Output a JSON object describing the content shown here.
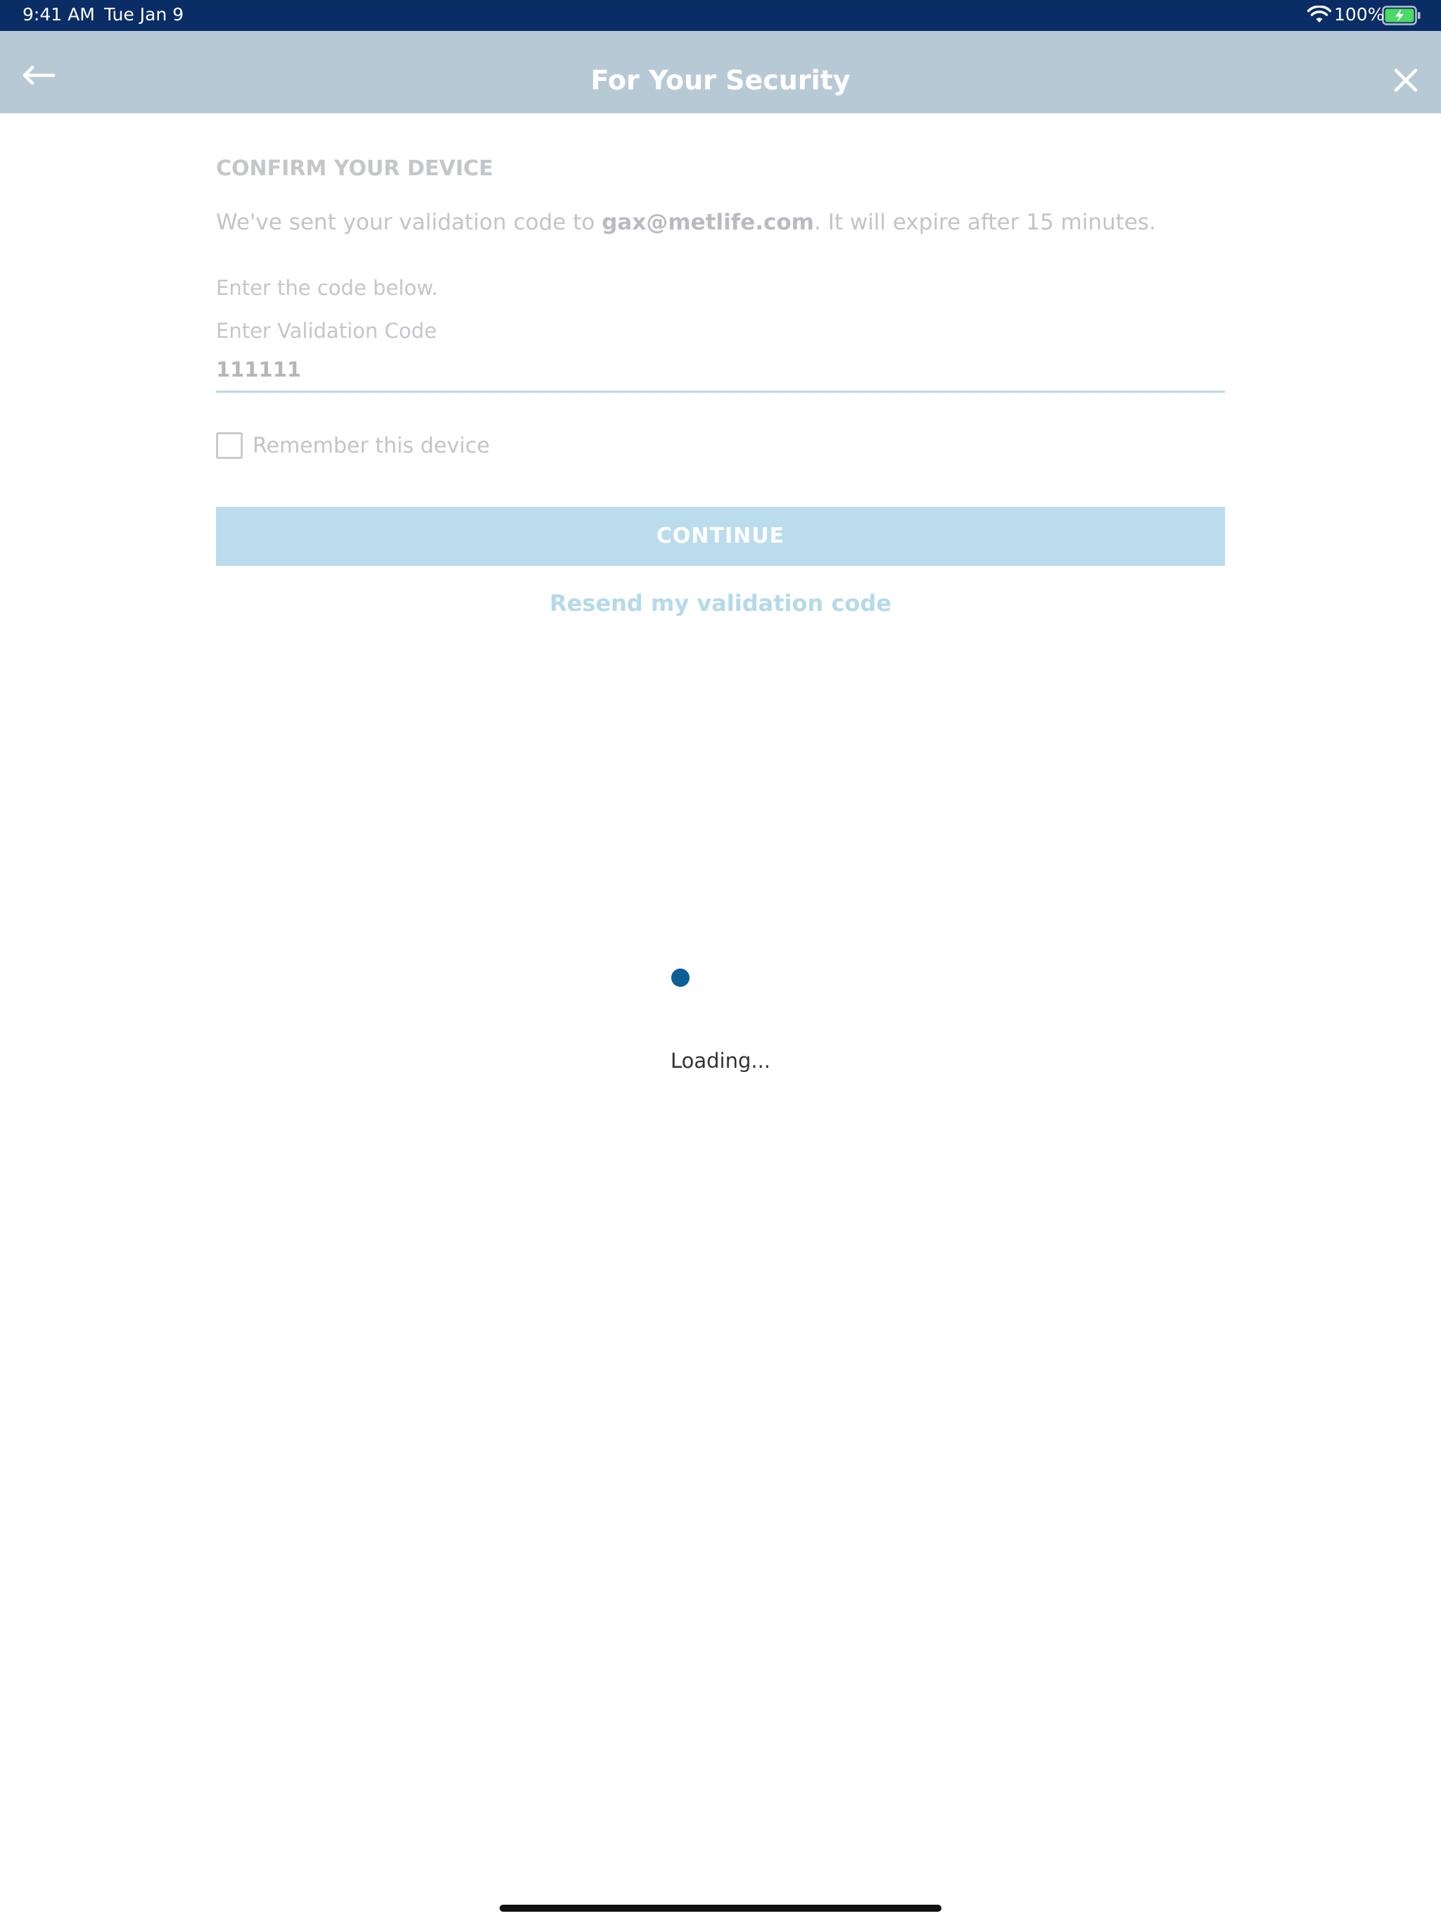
{
  "status_bar": {
    "time": "9:41 AM",
    "date": "Tue Jan 9",
    "battery_percent": "100%",
    "battery_level": 1.0,
    "wifi_icon": "wifi-icon",
    "battery_icon": "battery-charging-icon"
  },
  "nav": {
    "title": "For Your Security",
    "back_icon": "arrow-left-icon",
    "close_icon": "close-icon"
  },
  "confirm": {
    "heading": "CONFIRM YOUR DEVICE",
    "sent_prefix": "We've sent your validation code to ",
    "email": "gax@metlife.com",
    "sent_suffix": ". It will expire after 15 minutes.",
    "instruction": "Enter the code below.",
    "field_label": "Enter Validation Code",
    "code_value": "111111",
    "remember_label": "Remember this device",
    "remember_checked": false,
    "continue_label": "CONTINUE",
    "resend_label": "Resend my validation code"
  },
  "loading": {
    "text": "Loading..."
  },
  "colors": {
    "status_bar": "#0a2d66",
    "nav_bar": "#b8c9d6",
    "continue_button": "#bbdcec",
    "resend_link": "#b5dae9",
    "spinner": "#0d5f96",
    "battery_fill": "#4cd964"
  }
}
